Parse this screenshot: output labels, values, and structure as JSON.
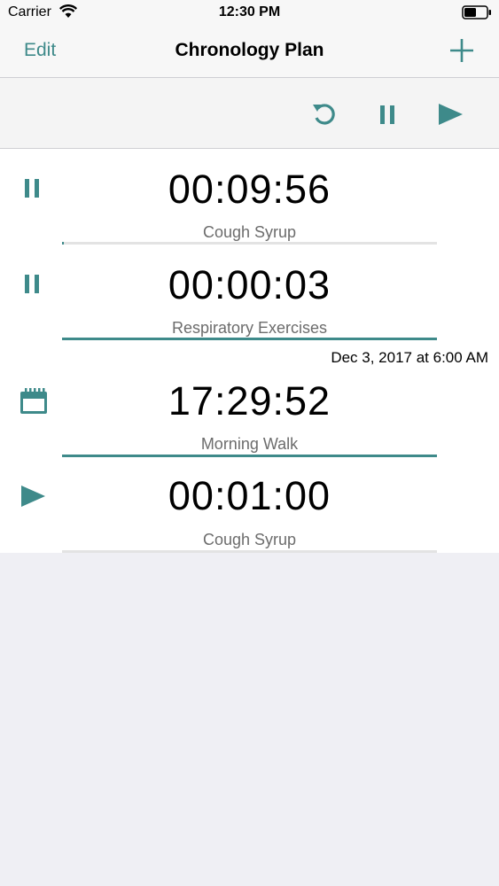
{
  "status": {
    "carrier": "Carrier",
    "time": "12:30 PM"
  },
  "nav": {
    "edit_label": "Edit",
    "title": "Chronology Plan"
  },
  "icons": {
    "wifi": "wifi-icon",
    "battery": "battery-icon",
    "add": "plus-icon",
    "reset": "reset-icon",
    "pause": "pause-icon",
    "play": "play-icon",
    "calendar": "calendar-icon"
  },
  "colors": {
    "accent": "#3e8a8a",
    "track": "#e3e3e3"
  },
  "timers": [
    {
      "time": "00:09:56",
      "label": "Cough Syrup",
      "state": "paused",
      "progress": 0.005,
      "schedule": ""
    },
    {
      "time": "00:00:03",
      "label": "Respiratory Exercises",
      "state": "paused",
      "progress": 1.0,
      "schedule": ""
    },
    {
      "time": "17:29:52",
      "label": "Morning Walk",
      "state": "scheduled",
      "progress": 1.0,
      "schedule": "Dec 3, 2017 at 6:00 AM"
    },
    {
      "time": "00:01:00",
      "label": "Cough Syrup",
      "state": "stopped",
      "progress": 0.0,
      "schedule": ""
    }
  ]
}
